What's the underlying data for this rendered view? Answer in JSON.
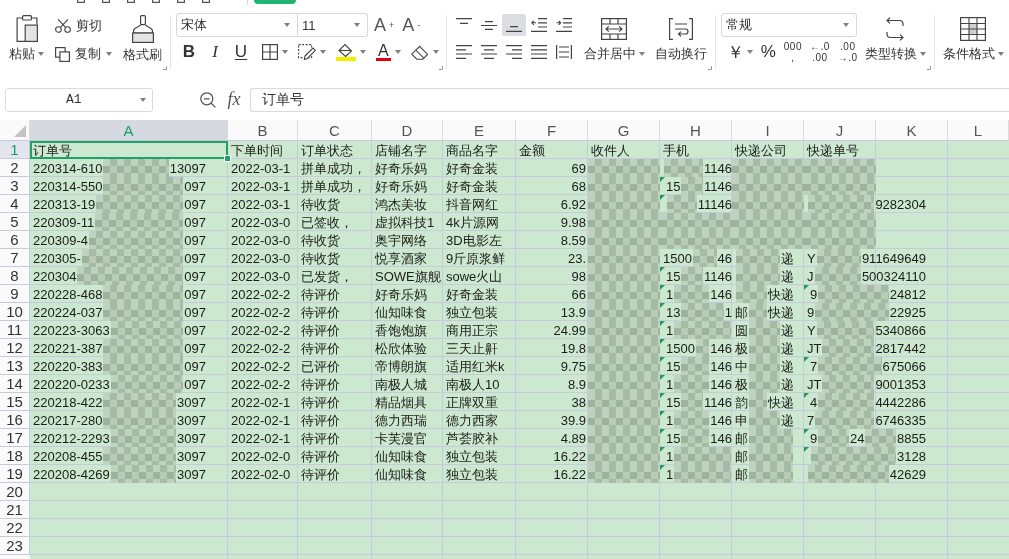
{
  "ribbon": {
    "clipboard": {
      "paste": "粘贴",
      "cut": "剪切",
      "copy": "复制",
      "format_painter": "格式刷"
    },
    "font": {
      "family": "宋体",
      "size": "11",
      "grow_button": "A$^{+}$",
      "shrink_button": "A$^{-}$",
      "style_buttons": [
        {
          "kind": "bold",
          "label": "B"
        },
        {
          "kind": "italic",
          "label": "I"
        },
        {
          "kind": "underline",
          "label": "U"
        }
      ],
      "font_color_label": "A"
    },
    "alignment": {
      "vertical": [
        {
          "kind": "top",
          "selected": false
        },
        {
          "kind": "middle",
          "selected": false
        },
        {
          "kind": "bottom",
          "selected": true
        }
      ],
      "horizontal": [
        {
          "kind": "left",
          "selected": false
        },
        {
          "kind": "center",
          "selected": false
        },
        {
          "kind": "right",
          "selected": false
        },
        {
          "kind": "justify",
          "selected": false
        },
        {
          "kind": "distributed",
          "selected": false
        }
      ],
      "merge": "合并居中",
      "wrap": "自动换行"
    },
    "number": {
      "format": "常规",
      "currency": "￥",
      "percent": "%",
      "thousands": "000\n,",
      "increase_decimal": "←.0\n.00",
      "decrease_decimal": ".00\n→.0",
      "convert": "类型转换"
    },
    "styles": {
      "conditional": "条件格式"
    }
  },
  "formula_bar": {
    "cell": "A1",
    "fx": "fx",
    "value": "订单号"
  },
  "sheet": {
    "columns": [
      {
        "label": "A",
        "selected": true
      },
      {
        "label": "B",
        "selected": false
      },
      {
        "label": "C",
        "selected": false
      },
      {
        "label": "D",
        "selected": false
      },
      {
        "label": "E",
        "selected": false
      },
      {
        "label": "F",
        "selected": false
      },
      {
        "label": "G",
        "selected": false
      },
      {
        "label": "H",
        "selected": false
      },
      {
        "label": "I",
        "selected": false
      },
      {
        "label": "J",
        "selected": false
      },
      {
        "label": "K",
        "selected": false
      },
      {
        "label": "L",
        "selected": false
      }
    ],
    "rows": [
      {
        "number": "1",
        "selected": true,
        "cells": [
          {
            "kind": "text",
            "text": "订单号"
          },
          {
            "kind": "text",
            "text": "下单时间"
          },
          {
            "kind": "text",
            "text": "订单状态"
          },
          {
            "kind": "text",
            "text": "店铺名字"
          },
          {
            "kind": "text",
            "text": "商品名字"
          },
          {
            "kind": "text",
            "text": "金额"
          },
          {
            "kind": "text",
            "text": "收件人"
          },
          {
            "kind": "text",
            "text": "手机",
            "flag": false
          },
          {
            "kind": "text",
            "text": "快递公司"
          },
          {
            "kind": "text",
            "text": "快递单号",
            "flag": false
          }
        ]
      },
      {
        "number": "2",
        "selected": false,
        "cells": [
          {
            "kind": "partial",
            "segments": [
              {
                "kind": "text",
                "text": "220314-610"
              },
              {
                "kind": "blur"
              },
              {
                "kind": "text",
                "text": "13097"
              }
            ]
          },
          {
            "kind": "text",
            "text": "2022-03-1"
          },
          {
            "kind": "text",
            "text": "拼单成功，"
          },
          {
            "kind": "text",
            "text": "好奇乐妈"
          },
          {
            "kind": "text",
            "text": "好奇金装"
          },
          {
            "kind": "number",
            "text": "69"
          },
          {
            "kind": "blur"
          },
          {
            "kind": "partial",
            "flag": false,
            "segments": [
              {
                "kind": "blur"
              },
              {
                "kind": "text",
                "text": "1146"
              }
            ]
          },
          {
            "kind": "blur"
          },
          {
            "kind": "blur",
            "flag": false
          }
        ]
      },
      {
        "number": "3",
        "selected": false,
        "cells": [
          {
            "kind": "partial",
            "segments": [
              {
                "kind": "text",
                "text": "220314-550"
              },
              {
                "kind": "blur"
              },
              {
                "kind": "text",
                "text": "097"
              }
            ]
          },
          {
            "kind": "text",
            "text": "2022-03-1"
          },
          {
            "kind": "text",
            "text": "拼单成功，"
          },
          {
            "kind": "text",
            "text": "好奇乐妈"
          },
          {
            "kind": "text",
            "text": "好奇金装"
          },
          {
            "kind": "number",
            "text": "68"
          },
          {
            "kind": "blur"
          },
          {
            "kind": "partial",
            "flag": true,
            "segments": [
              {
                "kind": "text",
                "text": "15"
              },
              {
                "kind": "blur"
              },
              {
                "kind": "text",
                "text": "1146"
              }
            ]
          },
          {
            "kind": "blur"
          },
          {
            "kind": "blur",
            "flag": false
          }
        ]
      },
      {
        "number": "4",
        "selected": false,
        "cells": [
          {
            "kind": "partial",
            "segments": [
              {
                "kind": "text",
                "text": "220313-19"
              },
              {
                "kind": "blur"
              },
              {
                "kind": "text",
                "text": "097"
              }
            ]
          },
          {
            "kind": "text",
            "text": "2022-03-1"
          },
          {
            "kind": "text",
            "text": "待收货"
          },
          {
            "kind": "text",
            "text": "鸿杰美妆"
          },
          {
            "kind": "text",
            "text": "抖音网红"
          },
          {
            "kind": "number",
            "text": "6.92"
          },
          {
            "kind": "blur"
          },
          {
            "kind": "partial",
            "flag": true,
            "segments": [
              {
                "kind": "blur"
              },
              {
                "kind": "text",
                "text": "11146"
              }
            ]
          },
          {
            "kind": "blur"
          },
          {
            "kind": "partial",
            "flag": false,
            "segments": [
              {
                "kind": "blur"
              },
              {
                "kind": "text",
                "text": "9282304"
              }
            ]
          }
        ]
      },
      {
        "number": "5",
        "selected": false,
        "cells": [
          {
            "kind": "partial",
            "segments": [
              {
                "kind": "text",
                "text": "220309-11"
              },
              {
                "kind": "blur"
              },
              {
                "kind": "text",
                "text": "097"
              }
            ]
          },
          {
            "kind": "text",
            "text": "2022-03-0"
          },
          {
            "kind": "text",
            "text": "已签收，"
          },
          {
            "kind": "text",
            "text": "虚拟科技1"
          },
          {
            "kind": "text",
            "text": "4k片源网"
          },
          {
            "kind": "number",
            "text": "9.98"
          },
          {
            "kind": "blur"
          },
          {
            "kind": "blur",
            "flag": false
          },
          {
            "kind": "blur"
          },
          {
            "kind": "blur",
            "flag": false
          }
        ]
      },
      {
        "number": "6",
        "selected": false,
        "cells": [
          {
            "kind": "partial",
            "segments": [
              {
                "kind": "text",
                "text": "220309-4"
              },
              {
                "kind": "blur"
              },
              {
                "kind": "text",
                "text": "097"
              }
            ]
          },
          {
            "kind": "text",
            "text": "2022-03-0"
          },
          {
            "kind": "text",
            "text": "待收货"
          },
          {
            "kind": "text",
            "text": "奥宇网络"
          },
          {
            "kind": "text",
            "text": "3D电影左"
          },
          {
            "kind": "number",
            "text": "8.59"
          },
          {
            "kind": "blur"
          },
          {
            "kind": "blur",
            "flag": false
          },
          {
            "kind": "blur"
          },
          {
            "kind": "blur",
            "flag": false
          }
        ]
      },
      {
        "number": "7",
        "selected": false,
        "cells": [
          {
            "kind": "partial",
            "segments": [
              {
                "kind": "text",
                "text": "220305-"
              },
              {
                "kind": "blur"
              },
              {
                "kind": "text",
                "text": "097"
              }
            ]
          },
          {
            "kind": "text",
            "text": "2022-03-0"
          },
          {
            "kind": "text",
            "text": "待收货"
          },
          {
            "kind": "text",
            "text": "悦享酒家"
          },
          {
            "kind": "text",
            "text": "9斤原浆鲜"
          },
          {
            "kind": "number",
            "text": "23."
          },
          {
            "kind": "blur"
          },
          {
            "kind": "partial",
            "flag": false,
            "segments": [
              {
                "kind": "text",
                "text": "1500"
              },
              {
                "kind": "blur"
              },
              {
                "kind": "text",
                "text": "46"
              }
            ]
          },
          {
            "kind": "partial",
            "segments": [
              {
                "kind": "blur"
              },
              {
                "kind": "text",
                "text": "递"
              }
            ]
          },
          {
            "kind": "partial",
            "flag": false,
            "segments": [
              {
                "kind": "text",
                "text": "Y"
              },
              {
                "kind": "blur"
              },
              {
                "kind": "text",
                "text": "911649649"
              }
            ]
          }
        ]
      },
      {
        "number": "8",
        "selected": false,
        "cells": [
          {
            "kind": "partial",
            "segments": [
              {
                "kind": "text",
                "text": "220304"
              },
              {
                "kind": "blur"
              },
              {
                "kind": "text",
                "text": "097"
              }
            ]
          },
          {
            "kind": "text",
            "text": "2022-03-0"
          },
          {
            "kind": "text",
            "text": "已发货，"
          },
          {
            "kind": "text",
            "text": "SOWE旗舰"
          },
          {
            "kind": "text",
            "text": "sowe火山"
          },
          {
            "kind": "number",
            "text": "98"
          },
          {
            "kind": "blur"
          },
          {
            "kind": "partial",
            "flag": true,
            "segments": [
              {
                "kind": "text",
                "text": "15"
              },
              {
                "kind": "blur"
              },
              {
                "kind": "text",
                "text": "1146"
              }
            ]
          },
          {
            "kind": "partial",
            "segments": [
              {
                "kind": "blur"
              },
              {
                "kind": "text",
                "text": "递"
              }
            ]
          },
          {
            "kind": "partial",
            "flag": false,
            "segments": [
              {
                "kind": "text",
                "text": "J"
              },
              {
                "kind": "blur"
              },
              {
                "kind": "text",
                "text": "500324110"
              }
            ]
          }
        ]
      },
      {
        "number": "9",
        "selected": false,
        "cells": [
          {
            "kind": "partial",
            "segments": [
              {
                "kind": "text",
                "text": "220228-468"
              },
              {
                "kind": "blur"
              },
              {
                "kind": "text",
                "text": "097"
              }
            ]
          },
          {
            "kind": "text",
            "text": "2022-02-2"
          },
          {
            "kind": "text",
            "text": "待评价"
          },
          {
            "kind": "text",
            "text": "好奇乐妈"
          },
          {
            "kind": "text",
            "text": "好奇金装"
          },
          {
            "kind": "number",
            "text": "66"
          },
          {
            "kind": "blur"
          },
          {
            "kind": "partial",
            "flag": true,
            "segments": [
              {
                "kind": "text",
                "text": "1"
              },
              {
                "kind": "blur"
              },
              {
                "kind": "text",
                "text": "146"
              }
            ]
          },
          {
            "kind": "partial",
            "segments": [
              {
                "kind": "blur"
              },
              {
                "kind": "text",
                "text": "快递"
              }
            ]
          },
          {
            "kind": "partial",
            "flag": true,
            "segments": [
              {
                "kind": "text",
                "text": "9"
              },
              {
                "kind": "blur"
              },
              {
                "kind": "text",
                "text": "24812"
              }
            ]
          }
        ]
      },
      {
        "number": "10",
        "selected": false,
        "cells": [
          {
            "kind": "partial",
            "segments": [
              {
                "kind": "text",
                "text": "220224-037"
              },
              {
                "kind": "blur"
              },
              {
                "kind": "text",
                "text": "097"
              }
            ]
          },
          {
            "kind": "text",
            "text": "2022-02-2"
          },
          {
            "kind": "text",
            "text": "待评价"
          },
          {
            "kind": "text",
            "text": "仙知味食"
          },
          {
            "kind": "text",
            "text": "独立包装"
          },
          {
            "kind": "number",
            "text": "13.9"
          },
          {
            "kind": "blur"
          },
          {
            "kind": "partial",
            "flag": true,
            "segments": [
              {
                "kind": "text",
                "text": "13"
              },
              {
                "kind": "blur"
              },
              {
                "kind": "text",
                "text": "1"
              }
            ]
          },
          {
            "kind": "partial",
            "segments": [
              {
                "kind": "text",
                "text": "邮"
              },
              {
                "kind": "blur"
              },
              {
                "kind": "text",
                "text": "快递"
              }
            ]
          },
          {
            "kind": "partial",
            "flag": false,
            "segments": [
              {
                "kind": "text",
                "text": "9"
              },
              {
                "kind": "blur"
              },
              {
                "kind": "text",
                "text": "22925"
              }
            ]
          }
        ]
      },
      {
        "number": "11",
        "selected": false,
        "cells": [
          {
            "kind": "partial",
            "segments": [
              {
                "kind": "text",
                "text": "220223-3063"
              },
              {
                "kind": "blur"
              },
              {
                "kind": "text",
                "text": "097"
              }
            ]
          },
          {
            "kind": "text",
            "text": "2022-02-2"
          },
          {
            "kind": "text",
            "text": "待评价"
          },
          {
            "kind": "text",
            "text": "香饱饱旗"
          },
          {
            "kind": "text",
            "text": "商用正宗"
          },
          {
            "kind": "number",
            "text": "24.99"
          },
          {
            "kind": "blur"
          },
          {
            "kind": "partial",
            "flag": true,
            "segments": [
              {
                "kind": "text",
                "text": "1"
              },
              {
                "kind": "blur"
              }
            ]
          },
          {
            "kind": "partial",
            "segments": [
              {
                "kind": "text",
                "text": "圆"
              },
              {
                "kind": "blur"
              },
              {
                "kind": "text",
                "text": "递"
              }
            ]
          },
          {
            "kind": "partial",
            "flag": false,
            "segments": [
              {
                "kind": "text",
                "text": "Y"
              },
              {
                "kind": "blur"
              },
              {
                "kind": "text",
                "text": "5340866"
              }
            ]
          }
        ]
      },
      {
        "number": "12",
        "selected": false,
        "cells": [
          {
            "kind": "partial",
            "segments": [
              {
                "kind": "text",
                "text": "220221-387"
              },
              {
                "kind": "blur"
              },
              {
                "kind": "text",
                "text": "097"
              }
            ]
          },
          {
            "kind": "text",
            "text": "2022-02-2"
          },
          {
            "kind": "text",
            "text": "待评价"
          },
          {
            "kind": "text",
            "text": "松欣体验"
          },
          {
            "kind": "text",
            "text": "三天止鼾"
          },
          {
            "kind": "number",
            "text": "19.8"
          },
          {
            "kind": "blur"
          },
          {
            "kind": "partial",
            "flag": true,
            "segments": [
              {
                "kind": "text",
                "text": "1500"
              },
              {
                "kind": "blur"
              },
              {
                "kind": "text",
                "text": "146"
              }
            ]
          },
          {
            "kind": "partial",
            "segments": [
              {
                "kind": "text",
                "text": "极"
              },
              {
                "kind": "blur"
              },
              {
                "kind": "text",
                "text": "递"
              }
            ]
          },
          {
            "kind": "partial",
            "flag": false,
            "segments": [
              {
                "kind": "text",
                "text": "JT"
              },
              {
                "kind": "blur"
              },
              {
                "kind": "text",
                "text": "2817442"
              }
            ]
          }
        ]
      },
      {
        "number": "13",
        "selected": false,
        "cells": [
          {
            "kind": "partial",
            "segments": [
              {
                "kind": "text",
                "text": "220220-383"
              },
              {
                "kind": "blur"
              },
              {
                "kind": "text",
                "text": "097"
              }
            ]
          },
          {
            "kind": "text",
            "text": "2022-02-2"
          },
          {
            "kind": "text",
            "text": "已评价"
          },
          {
            "kind": "text",
            "text": "帝博朗旗"
          },
          {
            "kind": "text",
            "text": "适用红米k"
          },
          {
            "kind": "number",
            "text": "9.75"
          },
          {
            "kind": "blur"
          },
          {
            "kind": "partial",
            "flag": true,
            "segments": [
              {
                "kind": "text",
                "text": "15"
              },
              {
                "kind": "blur"
              },
              {
                "kind": "text",
                "text": "146"
              }
            ]
          },
          {
            "kind": "partial",
            "segments": [
              {
                "kind": "text",
                "text": "中"
              },
              {
                "kind": "blur"
              },
              {
                "kind": "text",
                "text": "递"
              }
            ]
          },
          {
            "kind": "partial",
            "flag": true,
            "segments": [
              {
                "kind": "text",
                "text": "7"
              },
              {
                "kind": "blur"
              },
              {
                "kind": "text",
                "text": "675066"
              }
            ]
          }
        ]
      },
      {
        "number": "14",
        "selected": false,
        "cells": [
          {
            "kind": "partial",
            "segments": [
              {
                "kind": "text",
                "text": "220220-0233"
              },
              {
                "kind": "blur"
              },
              {
                "kind": "text",
                "text": "097"
              }
            ]
          },
          {
            "kind": "text",
            "text": "2022-02-2"
          },
          {
            "kind": "text",
            "text": "待评价"
          },
          {
            "kind": "text",
            "text": "南极人城"
          },
          {
            "kind": "text",
            "text": "南极人10"
          },
          {
            "kind": "number",
            "text": "8.9"
          },
          {
            "kind": "blur"
          },
          {
            "kind": "partial",
            "flag": true,
            "segments": [
              {
                "kind": "text",
                "text": "1"
              },
              {
                "kind": "blur"
              },
              {
                "kind": "text",
                "text": "146"
              }
            ]
          },
          {
            "kind": "partial",
            "segments": [
              {
                "kind": "text",
                "text": "极"
              },
              {
                "kind": "blur"
              },
              {
                "kind": "text",
                "text": "递"
              }
            ]
          },
          {
            "kind": "partial",
            "flag": false,
            "segments": [
              {
                "kind": "text",
                "text": "JT"
              },
              {
                "kind": "blur"
              },
              {
                "kind": "text",
                "text": "9001353"
              }
            ]
          }
        ]
      },
      {
        "number": "15",
        "selected": false,
        "cells": [
          {
            "kind": "partial",
            "segments": [
              {
                "kind": "text",
                "text": "220218-422"
              },
              {
                "kind": "blur"
              },
              {
                "kind": "text",
                "text": "3097"
              }
            ]
          },
          {
            "kind": "text",
            "text": "2022-02-1"
          },
          {
            "kind": "text",
            "text": "待评价"
          },
          {
            "kind": "text",
            "text": "精品烟具"
          },
          {
            "kind": "text",
            "text": "正牌双重"
          },
          {
            "kind": "number",
            "text": "38"
          },
          {
            "kind": "blur"
          },
          {
            "kind": "partial",
            "flag": true,
            "segments": [
              {
                "kind": "text",
                "text": "15"
              },
              {
                "kind": "blur"
              },
              {
                "kind": "text",
                "text": "1146"
              }
            ]
          },
          {
            "kind": "partial",
            "segments": [
              {
                "kind": "text",
                "text": "韵"
              },
              {
                "kind": "blur"
              },
              {
                "kind": "text",
                "text": "快递"
              }
            ]
          },
          {
            "kind": "partial",
            "flag": true,
            "segments": [
              {
                "kind": "text",
                "text": "4"
              },
              {
                "kind": "blur"
              },
              {
                "kind": "text",
                "text": "4442286"
              }
            ]
          }
        ]
      },
      {
        "number": "16",
        "selected": false,
        "cells": [
          {
            "kind": "partial",
            "segments": [
              {
                "kind": "text",
                "text": "220217-280"
              },
              {
                "kind": "blur"
              },
              {
                "kind": "text",
                "text": "3097"
              }
            ]
          },
          {
            "kind": "text",
            "text": "2022-02-1"
          },
          {
            "kind": "text",
            "text": "待评价"
          },
          {
            "kind": "text",
            "text": "德力西瑞"
          },
          {
            "kind": "text",
            "text": "德力西家"
          },
          {
            "kind": "number",
            "text": "39.9"
          },
          {
            "kind": "blur"
          },
          {
            "kind": "partial",
            "flag": true,
            "segments": [
              {
                "kind": "text",
                "text": "1"
              },
              {
                "kind": "blur"
              },
              {
                "kind": "text",
                "text": "146"
              }
            ]
          },
          {
            "kind": "partial",
            "segments": [
              {
                "kind": "text",
                "text": "申"
              },
              {
                "kind": "blur"
              },
              {
                "kind": "text",
                "text": "递"
              }
            ]
          },
          {
            "kind": "partial",
            "flag": false,
            "segments": [
              {
                "kind": "text",
                "text": "7"
              },
              {
                "kind": "blur"
              },
              {
                "kind": "text",
                "text": "6746335"
              }
            ]
          }
        ]
      },
      {
        "number": "17",
        "selected": false,
        "cells": [
          {
            "kind": "partial",
            "segments": [
              {
                "kind": "text",
                "text": "220212-2293"
              },
              {
                "kind": "blur"
              },
              {
                "kind": "text",
                "text": "3097"
              }
            ]
          },
          {
            "kind": "text",
            "text": "2022-02-1"
          },
          {
            "kind": "text",
            "text": "待评价"
          },
          {
            "kind": "text",
            "text": "卡芙漫官"
          },
          {
            "kind": "text",
            "text": "芦荟胶补"
          },
          {
            "kind": "number",
            "text": "4.89"
          },
          {
            "kind": "blur"
          },
          {
            "kind": "partial",
            "flag": true,
            "segments": [
              {
                "kind": "text",
                "text": "15"
              },
              {
                "kind": "blur"
              },
              {
                "kind": "text",
                "text": "146"
              }
            ]
          },
          {
            "kind": "partial",
            "segments": [
              {
                "kind": "text",
                "text": "邮"
              },
              {
                "kind": "blur"
              }
            ]
          },
          {
            "kind": "partial",
            "flag": true,
            "segments": [
              {
                "kind": "text",
                "text": "9"
              },
              {
                "kind": "blur"
              },
              {
                "kind": "text",
                "text": "24"
              },
              {
                "kind": "blur"
              },
              {
                "kind": "text",
                "text": "8855"
              }
            ]
          }
        ]
      },
      {
        "number": "18",
        "selected": false,
        "cells": [
          {
            "kind": "partial",
            "segments": [
              {
                "kind": "text",
                "text": "220208-455"
              },
              {
                "kind": "blur"
              },
              {
                "kind": "text",
                "text": "3097"
              }
            ]
          },
          {
            "kind": "text",
            "text": "2022-02-0"
          },
          {
            "kind": "text",
            "text": "待评价"
          },
          {
            "kind": "text",
            "text": "仙知味食"
          },
          {
            "kind": "text",
            "text": "独立包装"
          },
          {
            "kind": "number",
            "text": "16.22"
          },
          {
            "kind": "blur"
          },
          {
            "kind": "partial",
            "flag": true,
            "segments": [
              {
                "kind": "text",
                "text": "1"
              },
              {
                "kind": "blur"
              }
            ]
          },
          {
            "kind": "partial",
            "segments": [
              {
                "kind": "text",
                "text": "邮"
              },
              {
                "kind": "blur"
              }
            ]
          },
          {
            "kind": "partial",
            "flag": true,
            "segments": [
              {
                "kind": "blur"
              },
              {
                "kind": "text",
                "text": "3128"
              }
            ]
          }
        ]
      },
      {
        "number": "19",
        "selected": false,
        "cells": [
          {
            "kind": "partial",
            "segments": [
              {
                "kind": "text",
                "text": "220208-4269"
              },
              {
                "kind": "blur"
              },
              {
                "kind": "text",
                "text": "3097"
              }
            ]
          },
          {
            "kind": "text",
            "text": "2022-02-0"
          },
          {
            "kind": "text",
            "text": "待评价"
          },
          {
            "kind": "text",
            "text": "仙知味食"
          },
          {
            "kind": "text",
            "text": "独立包装"
          },
          {
            "kind": "number",
            "text": "16.22"
          },
          {
            "kind": "blur"
          },
          {
            "kind": "partial",
            "flag": true,
            "segments": [
              {
                "kind": "text",
                "text": "1"
              },
              {
                "kind": "blur"
              }
            ]
          },
          {
            "kind": "partial",
            "segments": [
              {
                "kind": "text",
                "text": "邮"
              },
              {
                "kind": "blur"
              }
            ]
          },
          {
            "kind": "partial",
            "flag": false,
            "segments": [
              {
                "kind": "blur"
              },
              {
                "kind": "text",
                "text": "42629"
              }
            ]
          }
        ]
      },
      {
        "number": "20",
        "selected": false
      },
      {
        "number": "21",
        "selected": false
      },
      {
        "number": "22",
        "selected": false
      },
      {
        "number": "23",
        "selected": false
      }
    ]
  }
}
